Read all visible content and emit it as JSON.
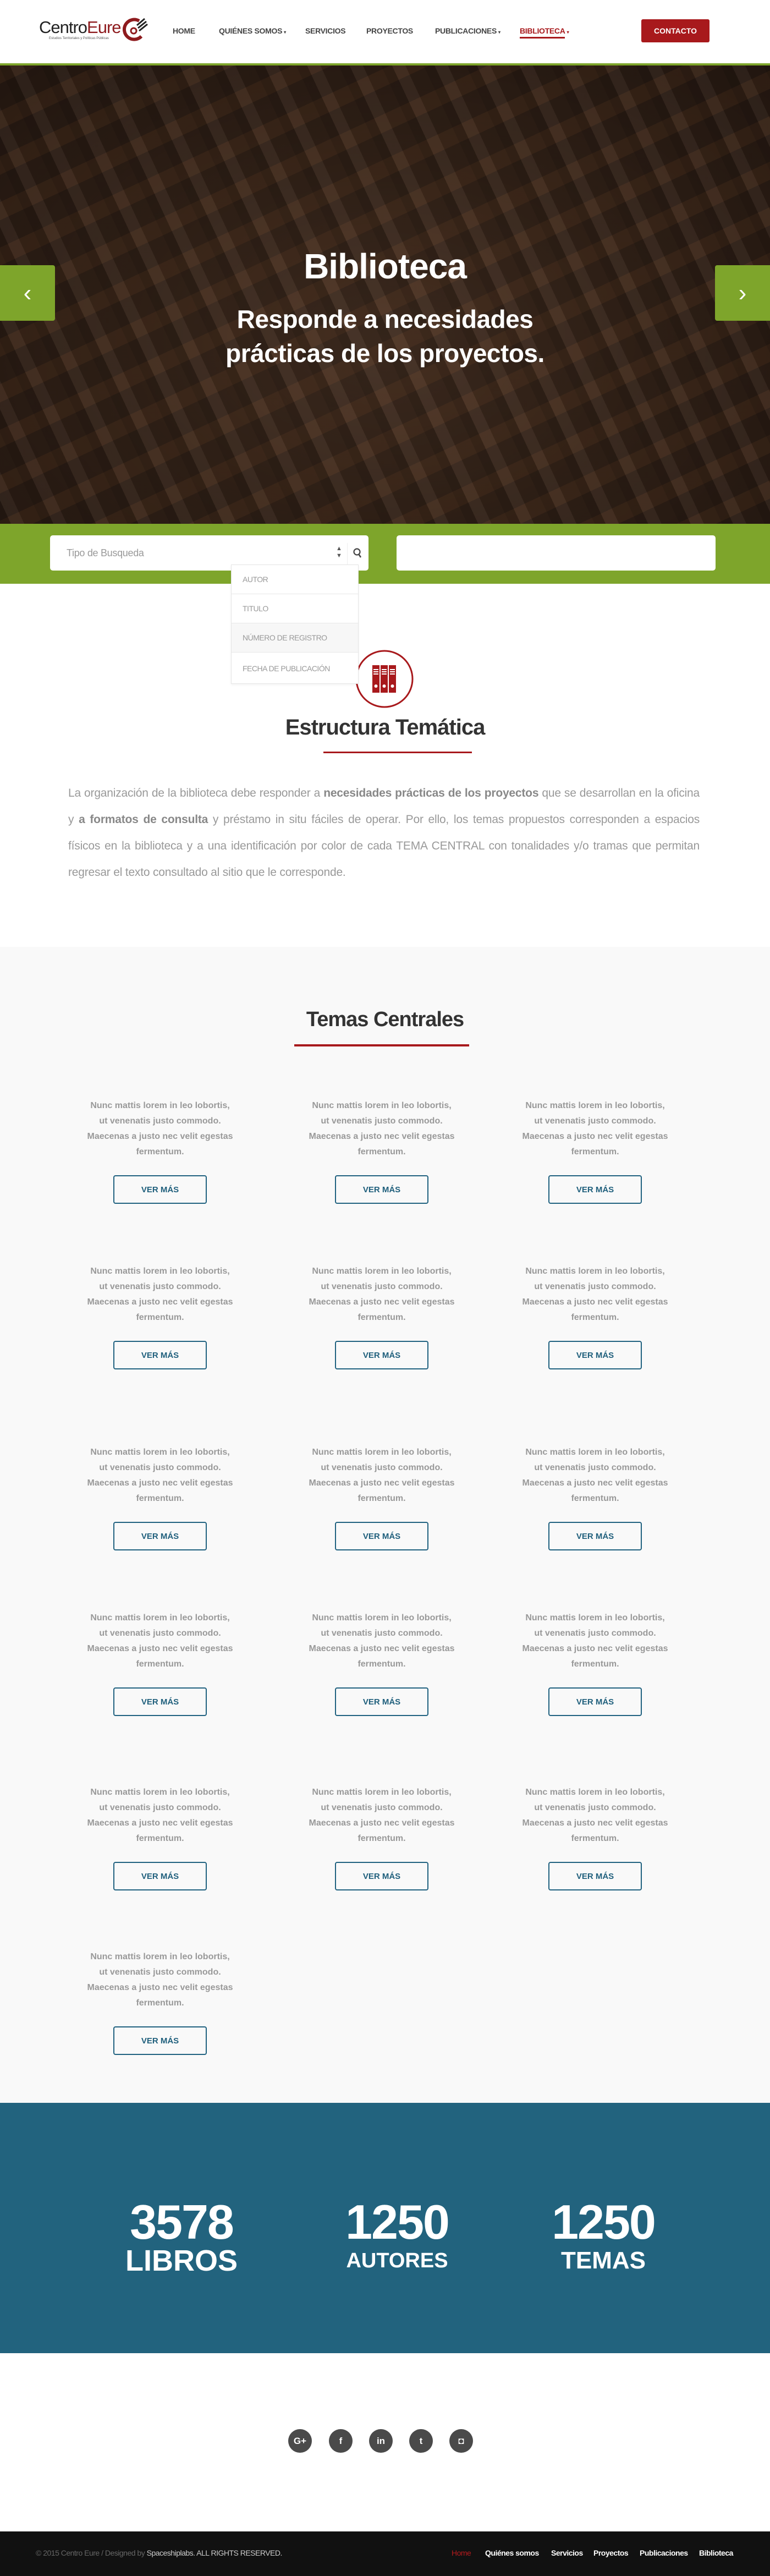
{
  "header": {
    "logo": {
      "part1": "Centro",
      "part2": "Eure",
      "tagline": "Estudios Territoriales y Políticas Públicas"
    },
    "nav": [
      {
        "label": "HOME",
        "caret": false
      },
      {
        "label": "QUIÉNES SOMOS",
        "caret": true
      },
      {
        "label": "SERVICIOS",
        "caret": false
      },
      {
        "label": "PROYECTOS",
        "caret": false
      },
      {
        "label": "PUBLICACIONES",
        "caret": true
      },
      {
        "label": "BIBLIOTECA",
        "caret": true,
        "active": true
      }
    ],
    "caret": "▾",
    "contact_label": "CONTACTO"
  },
  "hero": {
    "title": "Biblioteca",
    "subtitle_line1": "Responde a necesidades",
    "subtitle_line2": "prácticas de los proyectos.",
    "prev": "‹",
    "next": "›"
  },
  "search": {
    "type_placeholder": "Tipo de Busqueda",
    "text_value": "",
    "options": [
      "AUTOR",
      "TITULO",
      "NÚMERO DE REGISTRO",
      "FECHA DE PUBLICACIÓN"
    ],
    "highlighted_option": 2
  },
  "estructura": {
    "title": "Estructura Temática",
    "p1": "La organización de la biblioteca debe responder a ",
    "b1": "necesidades prácticas de los proyectos",
    "p2": " que se desarrollan en la oficina y ",
    "b2": "a formatos de consulta",
    "p3": " y préstamo in situ fáciles de operar. Por ello, los temas propuestos corresponden a espacios físicos en la biblioteca y a una identificación por color de cada TEMA CENTRAL con tonalidades y/o tramas que permitan regresar el texto consultado al sitio que le corresponde."
  },
  "temas": {
    "title": "Temas Centrales",
    "cards": [
      {
        "text": "Nunc mattis lorem in leo lobortis, ut venenatis justo commodo. Maecenas a justo nec velit egestas fermentum.",
        "button": "VER MÁS"
      },
      {
        "text": "Nunc mattis lorem in leo lobortis, ut venenatis justo commodo. Maecenas a justo nec velit egestas fermentum.",
        "button": "VER MÁS"
      },
      {
        "text": "Nunc mattis lorem in leo lobortis, ut venenatis justo commodo. Maecenas a justo nec velit egestas fermentum.",
        "button": "VER MÁS"
      },
      {
        "text": "Nunc mattis lorem in leo lobortis, ut venenatis justo commodo. Maecenas a justo nec velit egestas fermentum.",
        "button": "VER MÁS"
      },
      {
        "text": "Nunc mattis lorem in leo lobortis, ut venenatis justo commodo. Maecenas a justo nec velit egestas fermentum.",
        "button": "VER MÁS"
      },
      {
        "text": "Nunc mattis lorem in leo lobortis, ut venenatis justo commodo. Maecenas a justo nec velit egestas fermentum.",
        "button": "VER MÁS"
      },
      {
        "text": "Nunc mattis lorem in leo lobortis, ut venenatis justo commodo. Maecenas a justo nec velit egestas fermentum.",
        "button": "VER MÁS"
      },
      {
        "text": "Nunc mattis lorem in leo lobortis, ut venenatis justo commodo. Maecenas a justo nec velit egestas fermentum.",
        "button": "VER MÁS"
      },
      {
        "text": "Nunc mattis lorem in leo lobortis, ut venenatis justo commodo. Maecenas a justo nec velit egestas fermentum.",
        "button": "VER MÁS"
      },
      {
        "text": "Nunc mattis lorem in leo lobortis, ut venenatis justo commodo. Maecenas a justo nec velit egestas fermentum.",
        "button": "VER MÁS"
      },
      {
        "text": "Nunc mattis lorem in leo lobortis, ut venenatis justo commodo. Maecenas a justo nec velit egestas fermentum.",
        "button": "VER MÁS"
      },
      {
        "text": "Nunc mattis lorem in leo lobortis, ut venenatis justo commodo. Maecenas a justo nec velit egestas fermentum.",
        "button": "VER MÁS"
      },
      {
        "text": "Nunc mattis lorem in leo lobortis, ut venenatis justo commodo. Maecenas a justo nec velit egestas fermentum.",
        "button": "VER MÁS"
      },
      {
        "text": "Nunc mattis lorem in leo lobortis, ut venenatis justo commodo. Maecenas a justo nec velit egestas fermentum.",
        "button": "VER MÁS"
      },
      {
        "text": "Nunc mattis lorem in leo lobortis, ut venenatis justo commodo. Maecenas a justo nec velit egestas fermentum.",
        "button": "VER MÁS"
      },
      {
        "text": "Nunc mattis lorem in leo lobortis, ut venenatis justo commodo. Maecenas a justo nec velit egestas fermentum.",
        "button": "VER MÁS"
      }
    ]
  },
  "stats": [
    {
      "number": "3578",
      "label": "LIBROS"
    },
    {
      "number": "1250",
      "label": "AUTORES"
    },
    {
      "number": "1250",
      "label": "TEMAS"
    }
  ],
  "social": [
    {
      "icon": "google-plus-icon",
      "glyph": "G+"
    },
    {
      "icon": "facebook-icon",
      "glyph": "f"
    },
    {
      "icon": "linkedin-icon",
      "glyph": "in"
    },
    {
      "icon": "twitter-icon",
      "glyph": "t"
    },
    {
      "icon": "instagram-icon",
      "glyph": "◘"
    }
  ],
  "footer": {
    "copyright": "© 2015 Centro Eure  /  Designed by ",
    "designer": "Spaceshiplabs. ALL RIGHTS RESERVED.",
    "links": [
      "Home",
      "Quiénes somos",
      "Servicios",
      "Proyectos",
      "Publicaciones",
      "Biblioteca"
    ]
  },
  "colors": {
    "green": "#7ea52b",
    "red": "#a8191c",
    "blue": "#22637e",
    "footer": "#111111"
  }
}
